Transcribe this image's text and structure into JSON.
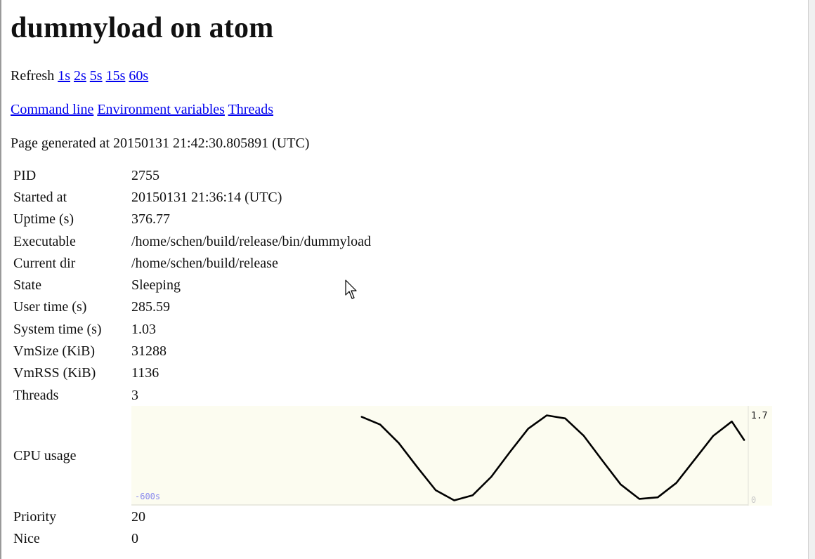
{
  "title": "dummyload on atom",
  "refresh": {
    "label": "Refresh",
    "options": [
      "1s",
      "2s",
      "5s",
      "15s",
      "60s"
    ]
  },
  "links": [
    "Command line",
    "Environment variables",
    "Threads"
  ],
  "generated": "Page generated at 20150131 21:42:30.805891 (UTC)",
  "rows": [
    {
      "key": "PID",
      "value": "2755"
    },
    {
      "key": "Started at",
      "value": "20150131 21:36:14 (UTC)"
    },
    {
      "key": "Uptime (s)",
      "value": "376.77"
    },
    {
      "key": "Executable",
      "value": "/home/schen/build/release/bin/dummyload"
    },
    {
      "key": "Current dir",
      "value": "/home/schen/build/release"
    },
    {
      "key": "State",
      "value": "Sleeping"
    },
    {
      "key": "User time (s)",
      "value": "285.59"
    },
    {
      "key": "System time (s)",
      "value": "1.03"
    },
    {
      "key": "VmSize (KiB)",
      "value": "31288"
    },
    {
      "key": "VmRSS (KiB)",
      "value": "1136"
    },
    {
      "key": "Threads",
      "value": "3"
    }
  ],
  "cpu": {
    "label": "CPU usage",
    "x_start_label": "-600s",
    "y_max_label": "1.7",
    "y_min_label": "0",
    "background": "#fcfcf0",
    "line_color": "#000000"
  },
  "chart_data": {
    "type": "line",
    "title": "",
    "xlabel": "",
    "ylabel": "",
    "xlim": [
      -600,
      0
    ],
    "ylim": [
      0,
      1.7
    ],
    "tick_labels": {
      "x": [
        "-600s"
      ],
      "y": [
        "1.7",
        "0"
      ]
    },
    "series": [
      {
        "x": [
          -376,
          -358,
          -340,
          -322,
          -304,
          -286,
          -268,
          -250,
          -232,
          -214,
          -196,
          -178,
          -160,
          -142,
          -124,
          -106,
          -88,
          -70,
          -52,
          -34,
          -16,
          -4
        ],
        "values": [
          1.65,
          1.5,
          1.14,
          0.67,
          0.22,
          0.02,
          0.12,
          0.48,
          0.96,
          1.42,
          1.68,
          1.62,
          1.28,
          0.8,
          0.33,
          0.05,
          0.08,
          0.36,
          0.82,
          1.28,
          1.56,
          1.2
        ]
      }
    ]
  },
  "tail_rows": [
    {
      "key": "Priority",
      "value": "20"
    },
    {
      "key": "Nice",
      "value": "0"
    }
  ]
}
